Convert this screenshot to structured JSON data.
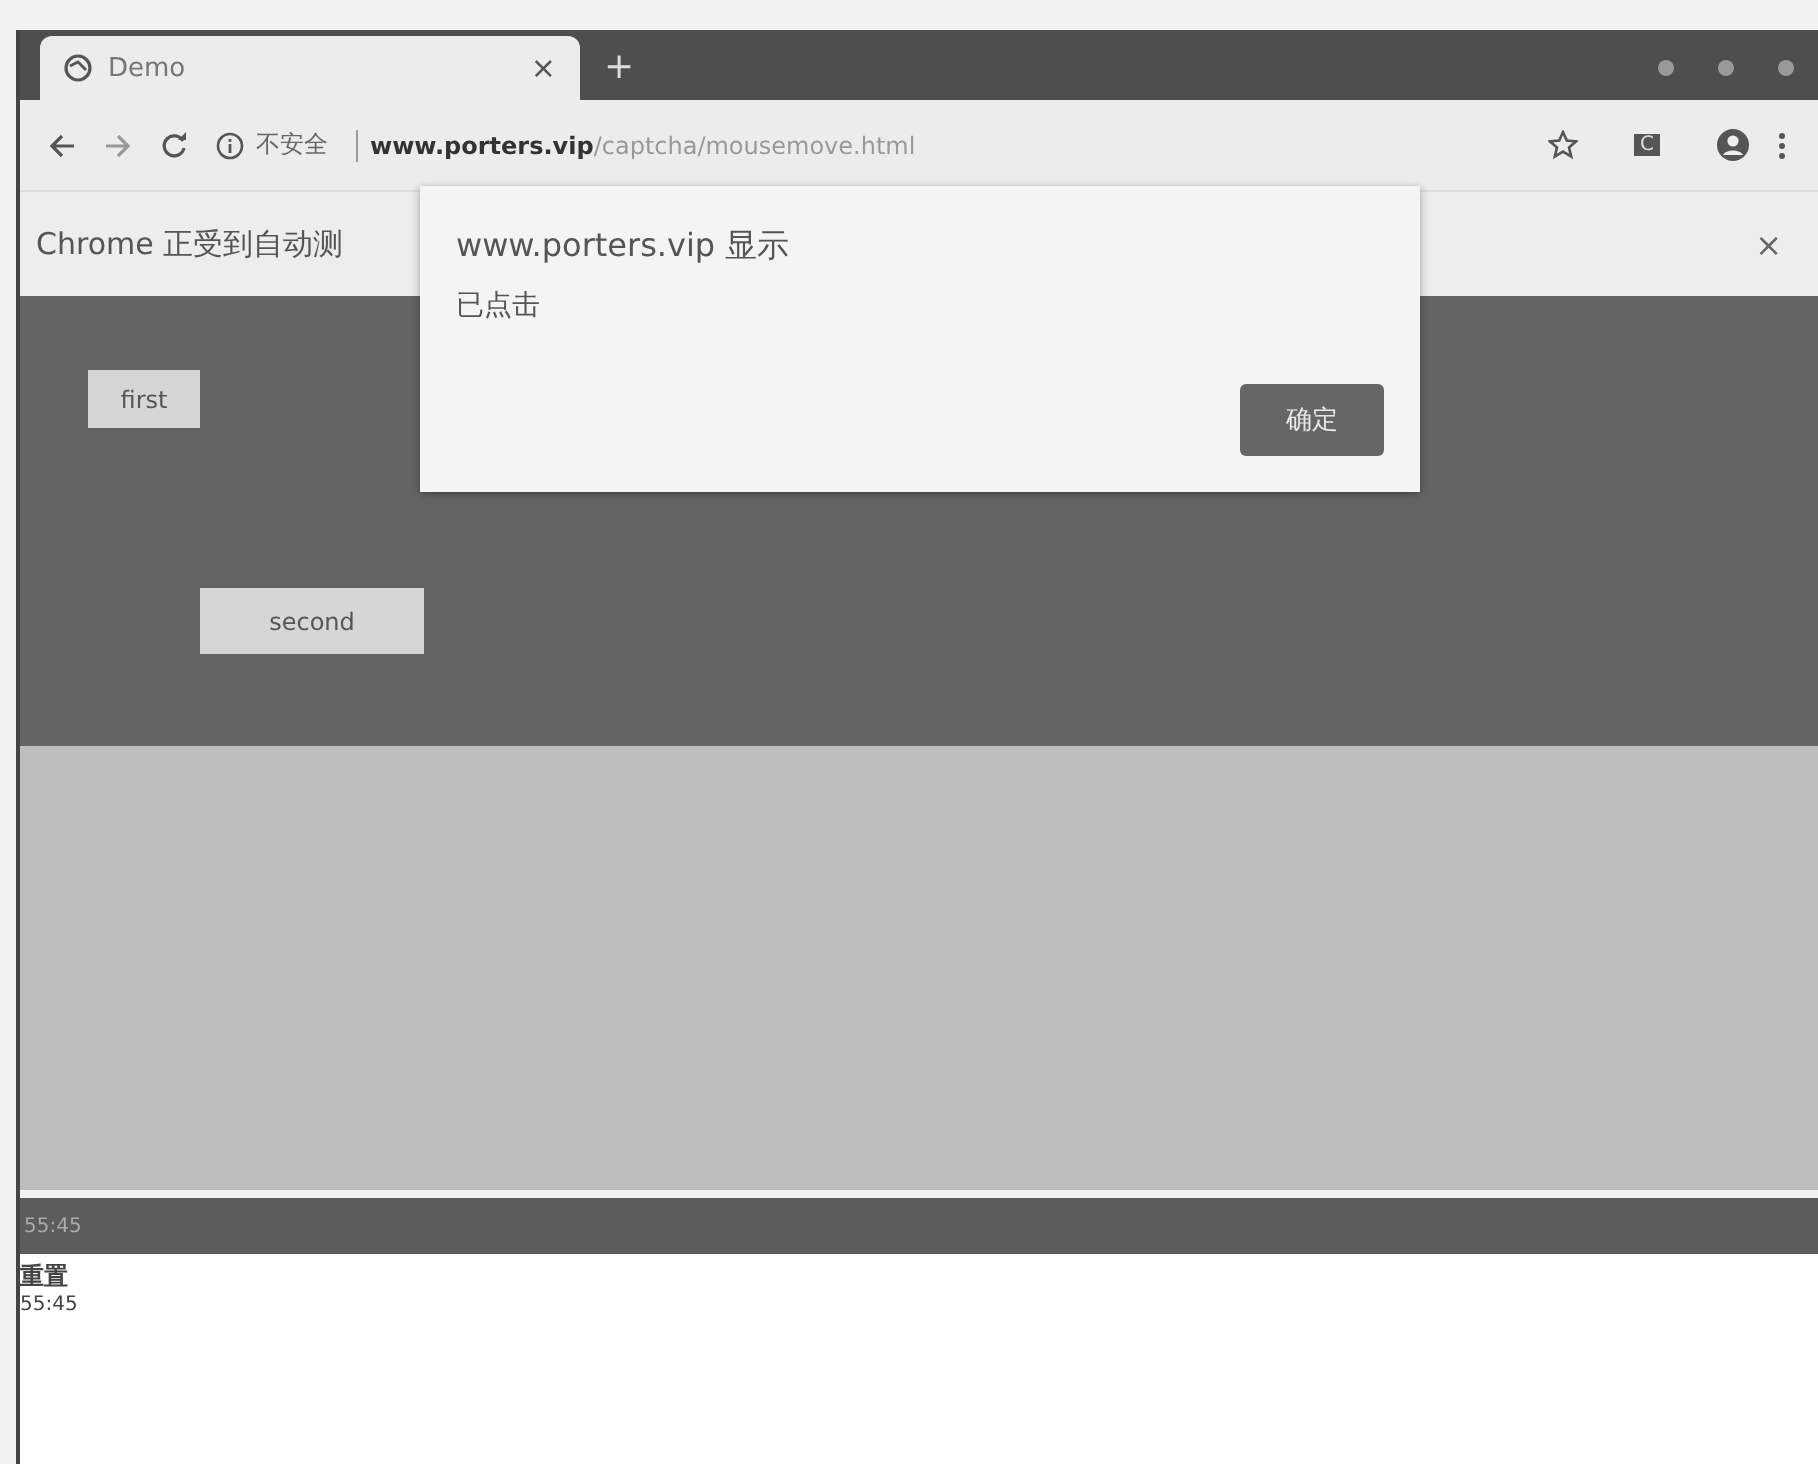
{
  "tab": {
    "title": "Demo",
    "close": "×",
    "new_tab": "+"
  },
  "toolbar": {
    "security": "不安全",
    "url_host": "www.porters.vip",
    "url_path": "/captcha/mousemove.html",
    "extension": "C"
  },
  "infobar": {
    "text": "Chrome 正受到自动测",
    "close": "×"
  },
  "page": {
    "buttons": [
      {
        "label": "first"
      },
      {
        "label": "second"
      }
    ],
    "status_bar": "55:45",
    "reset_label": "重置",
    "time": "55:45"
  },
  "dialog": {
    "title": "www.porters.vip 显示",
    "message": "已点击",
    "ok": "确定"
  }
}
